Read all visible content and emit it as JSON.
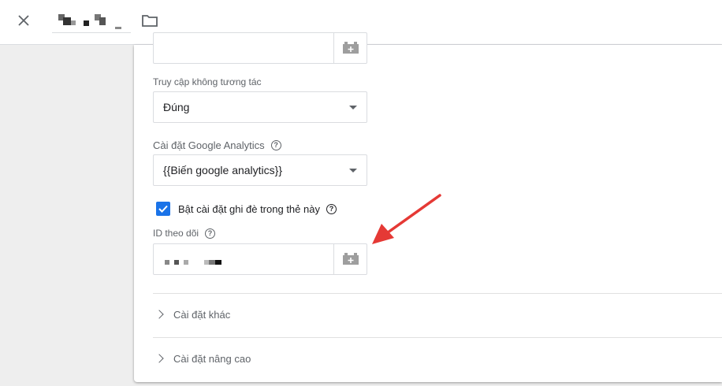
{
  "header": {
    "close_icon": "close-icon",
    "folder_icon": "folder-icon"
  },
  "fields": {
    "non_interaction_label": "Truy cập không tương tác",
    "non_interaction_value": "Đúng",
    "ga_settings_label": "Cài đặt Google Analytics",
    "ga_settings_value": "{{Biến google analytics}}",
    "override_label": "Bật cài đặt ghi đè trong thẻ này",
    "tracking_id_label": "ID theo dõi"
  },
  "sections": {
    "more_settings": "Cài đặt khác",
    "advanced_settings": "Cài đặt nâng cao"
  },
  "colors": {
    "accent": "#1a73e8",
    "arrow": "#e53935"
  }
}
